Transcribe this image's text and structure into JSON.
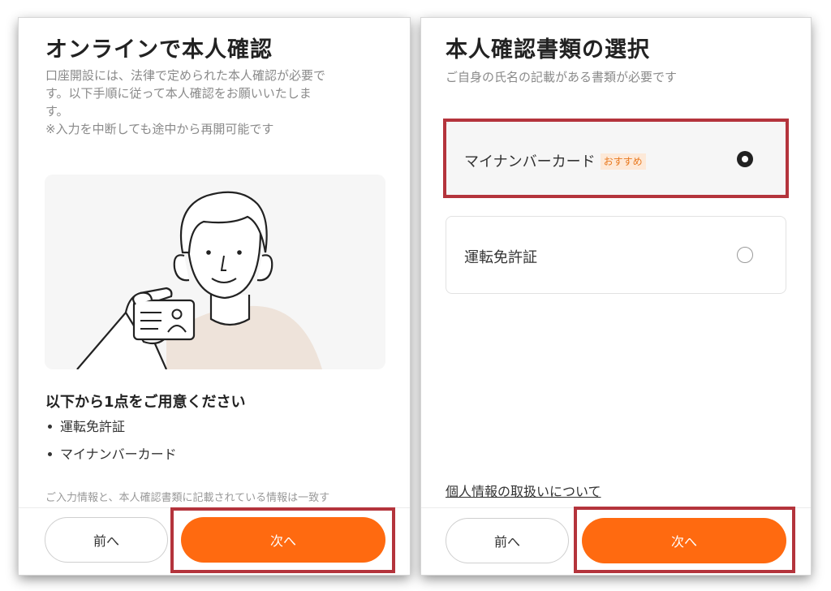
{
  "left_screen": {
    "title": "オンラインで本人確認",
    "intro": [
      "口座開設には、法律で定められた本人確認が必要で",
      "す。以下手順に従って本人確認をお願いいたしま",
      "す。",
      "※入力を中断しても途中から再開可能です"
    ],
    "prep_title": "以下から1点をご用意ください",
    "documents": [
      "運転免許証",
      "マイナンバーカード"
    ],
    "notice": "ご入力情報と、本人確認書類に記載されている情報は一致す",
    "prev_label": "前へ",
    "next_label": "次へ"
  },
  "right_screen": {
    "title": "本人確認書類の選択",
    "subtitle": "ご自身の氏名の記載がある書類が必要です",
    "options": [
      {
        "label": "マイナンバーカード",
        "badge": "おすすめ",
        "selected": true
      },
      {
        "label": "運転免許証",
        "selected": false
      }
    ],
    "privacy_link": "個人情報の取扱いについて",
    "prev_label": "前へ",
    "next_label": "次へ"
  },
  "colors": {
    "accent": "#ff6a10",
    "highlight": "#b4343c",
    "badge_bg": "#fde9d8",
    "badge_text": "#e8781e"
  },
  "icons": [
    "id-card-person-illustration",
    "radio-selected-icon",
    "radio-unselected-icon"
  ]
}
